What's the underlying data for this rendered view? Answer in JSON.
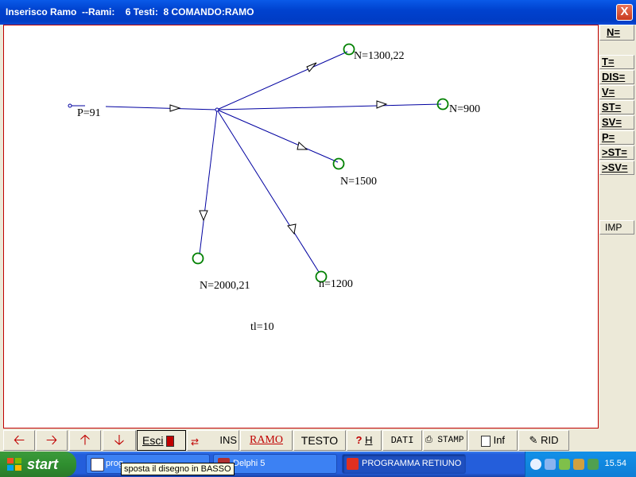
{
  "window": {
    "title": "Inserisco Ramo  --Rami:    6 Testi:  8 COMANDO:RAMO",
    "close_label": "X"
  },
  "canvas": {
    "labels": {
      "p": "P=91",
      "n1300": "N=1300,22",
      "n900": "N=900",
      "n1500": "N=1500",
      "n2000": "N=2000,21",
      "n1200": "n=1200",
      "tl": "tl=10"
    },
    "line_color": "#0000a0",
    "node_color": "#008000"
  },
  "right_panel": {
    "buttons": [
      "N=",
      "T=",
      "DIS=",
      "V=",
      "ST=",
      "SV=",
      "P=",
      ">ST=",
      ">SV=",
      "IMP"
    ]
  },
  "toolbar": {
    "left_icon": "arrow-left-icon",
    "right_icon": "arrow-right-icon",
    "up_icon": "arrow-up-icon",
    "down_icon": "arrow-down-icon",
    "esci": "Esci",
    "ins": "INS",
    "ramo": "RAMO",
    "testo": "TESTO",
    "help": "H",
    "dati": "DATI",
    "stampa": "STAMP",
    "inf": "Inf",
    "rid": "RID"
  },
  "taskbar": {
    "start": "start",
    "tasks": [
      "prog",
      "Delphi 5",
      "PROGRAMMA RETIUNO"
    ],
    "clock": "15.54"
  },
  "tooltip": "sposta il disegno in BASSO"
}
